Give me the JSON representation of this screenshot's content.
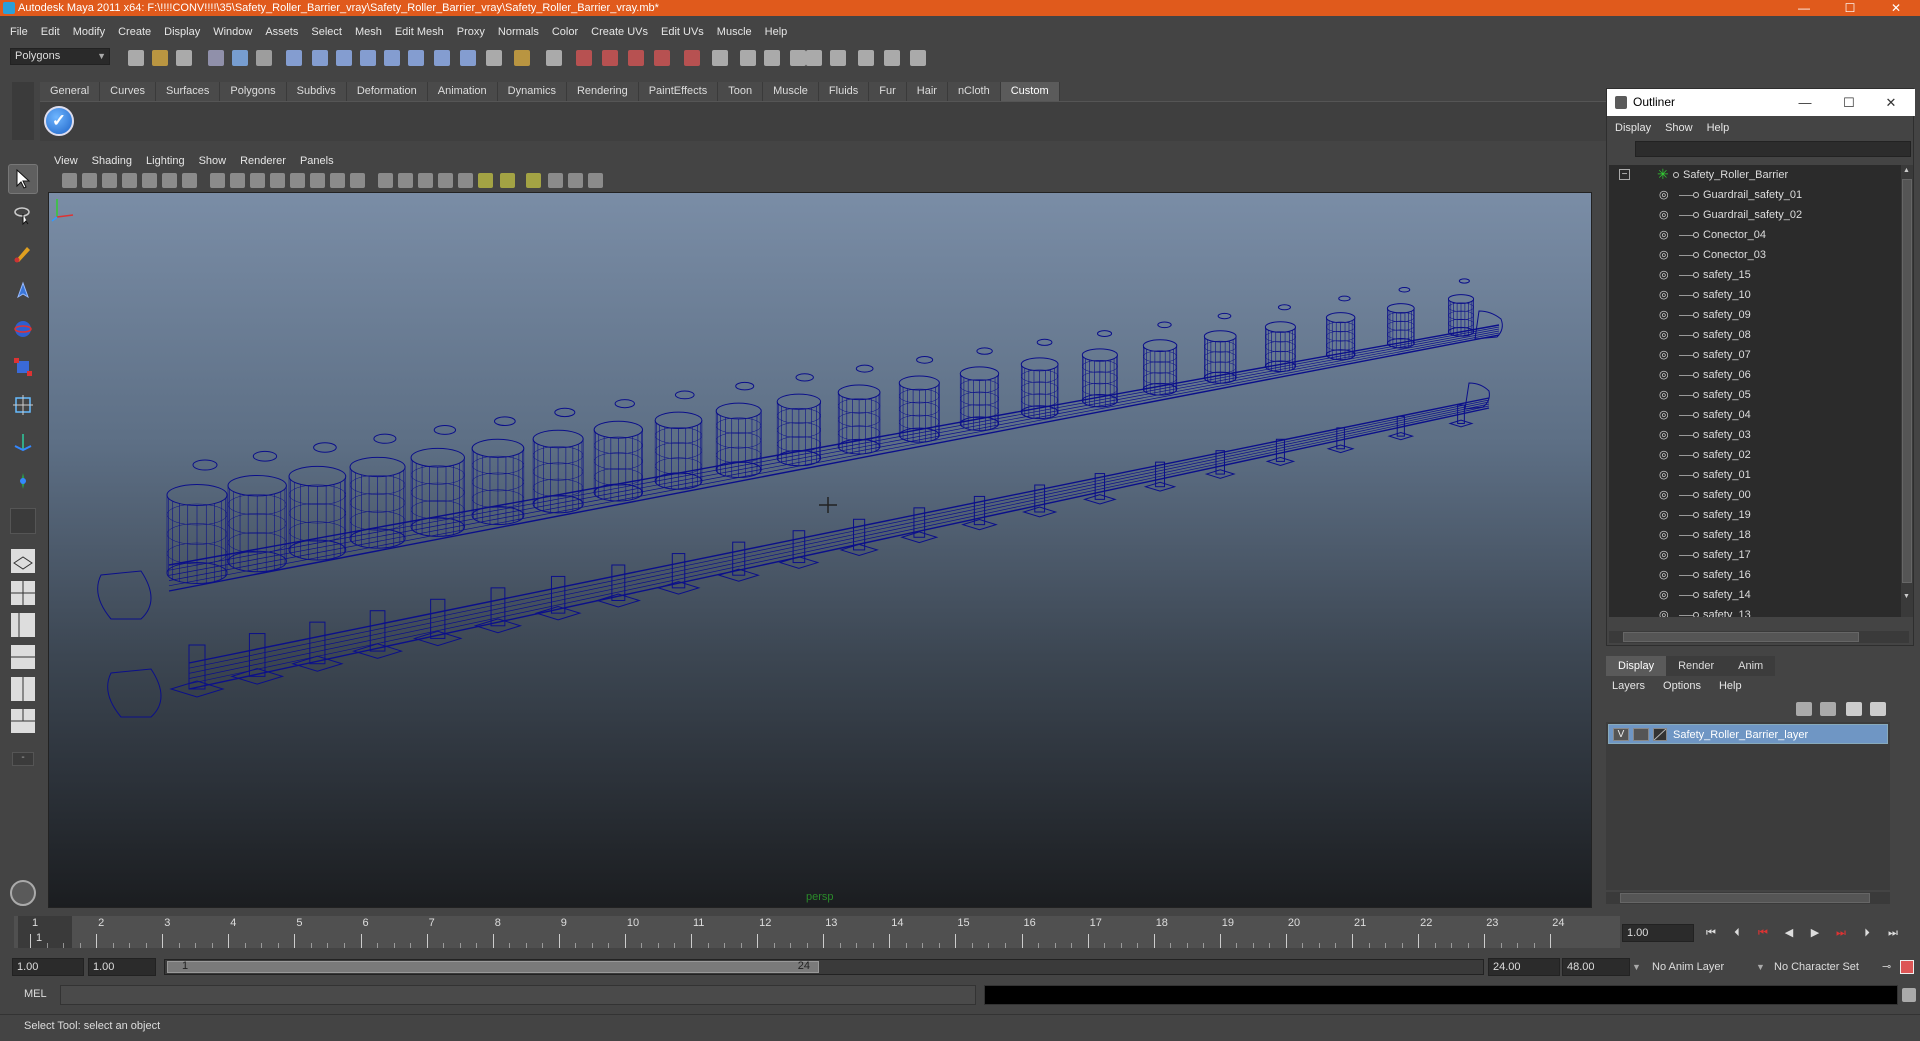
{
  "window": {
    "title": "Autodesk Maya 2011 x64: F:\\!!!!CONV!!!!\\35\\Safety_Roller_Barrier_vray\\Safety_Roller_Barrier_vray\\Safety_Roller_Barrier_vray.mb*",
    "minimize": "—",
    "maximize": "☐",
    "close": "✕"
  },
  "menubar": [
    "File",
    "Edit",
    "Modify",
    "Create",
    "Display",
    "Window",
    "Assets",
    "Select",
    "Mesh",
    "Edit Mesh",
    "Proxy",
    "Normals",
    "Color",
    "Create UVs",
    "Edit UVs",
    "Muscle",
    "Help"
  ],
  "statusline": {
    "mode": "Polygons"
  },
  "shelf": {
    "tabs": [
      "General",
      "Curves",
      "Surfaces",
      "Polygons",
      "Subdivs",
      "Deformation",
      "Animation",
      "Dynamics",
      "Rendering",
      "PaintEffects",
      "Toon",
      "Muscle",
      "Fluids",
      "Fur",
      "Hair",
      "nCloth",
      "Custom"
    ],
    "active_tab": "Custom"
  },
  "viewport": {
    "menu": [
      "View",
      "Shading",
      "Lighting",
      "Show",
      "Renderer",
      "Panels"
    ],
    "camera": "persp"
  },
  "outliner": {
    "title": "Outliner",
    "menu": [
      "Display",
      "Show",
      "Help"
    ],
    "root": "Safety_Roller_Barrier",
    "items": [
      "Guardrail_safety_01",
      "Guardrail_safety_02",
      "Conector_04",
      "Conector_03",
      "safety_15",
      "safety_10",
      "safety_09",
      "safety_08",
      "safety_07",
      "safety_06",
      "safety_05",
      "safety_04",
      "safety_03",
      "safety_02",
      "safety_01",
      "safety_00",
      "safety_19",
      "safety_18",
      "safety_17",
      "safety_16",
      "safety_14",
      "safety_13"
    ]
  },
  "layers": {
    "tabs": [
      "Display",
      "Render",
      "Anim"
    ],
    "active_tab": "Display",
    "menu": [
      "Layers",
      "Options",
      "Help"
    ],
    "layer_name": "Safety_Roller_Barrier_layer",
    "visibility": "V"
  },
  "timeslider": {
    "labels": [
      "1",
      "2",
      "3",
      "4",
      "5",
      "6",
      "7",
      "8",
      "9",
      "10",
      "11",
      "12",
      "13",
      "14",
      "15",
      "16",
      "17",
      "18",
      "19",
      "20",
      "21",
      "22",
      "23",
      "24"
    ],
    "current_marker": "1",
    "current_time": "1.00"
  },
  "range": {
    "start_time": "1.00",
    "playback_start": "1.00",
    "range_start_label": "1",
    "range_end_label": "24",
    "playback_end": "24.00",
    "end_time": "48.00",
    "anim_layer": "No Anim Layer",
    "character_set": "No Character Set"
  },
  "commandline": {
    "label": "MEL"
  },
  "helpline": {
    "text": "Select Tool: select an object"
  },
  "colors": {
    "titlebar": "#e05a1c",
    "wireframe": "#0b0f8a",
    "layer_selected": "#6f96c4"
  }
}
